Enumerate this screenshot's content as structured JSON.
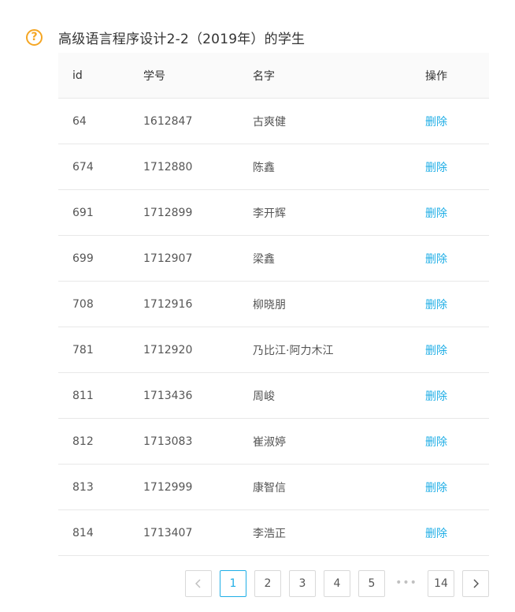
{
  "dialog": {
    "title": "高级语言程序设计2-2（2019年）的学生",
    "icon": "question-circle-icon",
    "icon_glyph": "?"
  },
  "table": {
    "headers": {
      "id": "id",
      "student_no": "学号",
      "name": "名字",
      "action": "操作"
    },
    "rows": [
      {
        "id": "64",
        "student_no": "1612847",
        "name": "古爽健",
        "action": "删除"
      },
      {
        "id": "674",
        "student_no": "1712880",
        "name": "陈鑫",
        "action": "删除"
      },
      {
        "id": "691",
        "student_no": "1712899",
        "name": "李开辉",
        "action": "删除"
      },
      {
        "id": "699",
        "student_no": "1712907",
        "name": "梁鑫",
        "action": "删除"
      },
      {
        "id": "708",
        "student_no": "1712916",
        "name": "柳晓朋",
        "action": "删除"
      },
      {
        "id": "781",
        "student_no": "1712920",
        "name": "乃比江·阿力木江",
        "action": "删除"
      },
      {
        "id": "811",
        "student_no": "1713436",
        "name": "周峻",
        "action": "删除"
      },
      {
        "id": "812",
        "student_no": "1713083",
        "name": "崔淑婷",
        "action": "删除"
      },
      {
        "id": "813",
        "student_no": "1712999",
        "name": "康智信",
        "action": "删除"
      },
      {
        "id": "814",
        "student_no": "1713407",
        "name": "李浩正",
        "action": "删除"
      }
    ]
  },
  "pagination": {
    "current": 1,
    "pages": [
      "1",
      "2",
      "3",
      "4",
      "5"
    ],
    "ellipsis": "•••",
    "last": "14",
    "prev_icon": "chevron-left-icon",
    "next_icon": "chevron-right-icon"
  },
  "colors": {
    "accent": "#1faee6",
    "warning": "#f5a623",
    "border": "#e8e8e8",
    "header_bg": "#fafafa"
  }
}
